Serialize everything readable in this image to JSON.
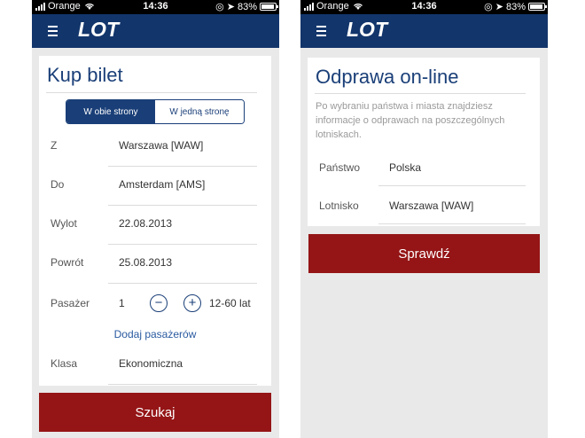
{
  "status_bar": {
    "carrier": "Orange",
    "time": "14:36",
    "battery": "83%",
    "battery_level": 0.83
  },
  "brand": {
    "logo_text": "LOT",
    "nav_color": "#12356b",
    "accent_color": "#951516"
  },
  "left_screen": {
    "title": "Kup bilet",
    "trip_type": {
      "options": [
        "W obie strony",
        "W jedną stronę"
      ],
      "selected": "W obie strony"
    },
    "fields": {
      "from": {
        "label": "Z",
        "value": "Warszawa [WAW]"
      },
      "to": {
        "label": "Do",
        "value": "Amsterdam [AMS]"
      },
      "departure": {
        "label": "Wylot",
        "value": "22.08.2013"
      },
      "return": {
        "label": "Powrót",
        "value": "25.08.2013"
      }
    },
    "passenger": {
      "label": "Pasażer",
      "count": "1",
      "minus": "−",
      "plus": "+",
      "age_range": "12-60 lat"
    },
    "add_passengers_link": "Dodaj pasażerów",
    "class": {
      "label": "Klasa",
      "value": "Ekonomiczna"
    },
    "search_button": "Szukaj"
  },
  "right_screen": {
    "title": "Odprawa on-line",
    "intro": "Po wybraniu państwa i miasta znajdziesz informacje o odprawach na poszczególnych lotniskach.",
    "fields": {
      "country": {
        "label": "Państwo",
        "value": "Polska"
      },
      "airport": {
        "label": "Lotnisko",
        "value": "Warszawa [WAW]"
      }
    },
    "check_button": "Sprawdź"
  }
}
